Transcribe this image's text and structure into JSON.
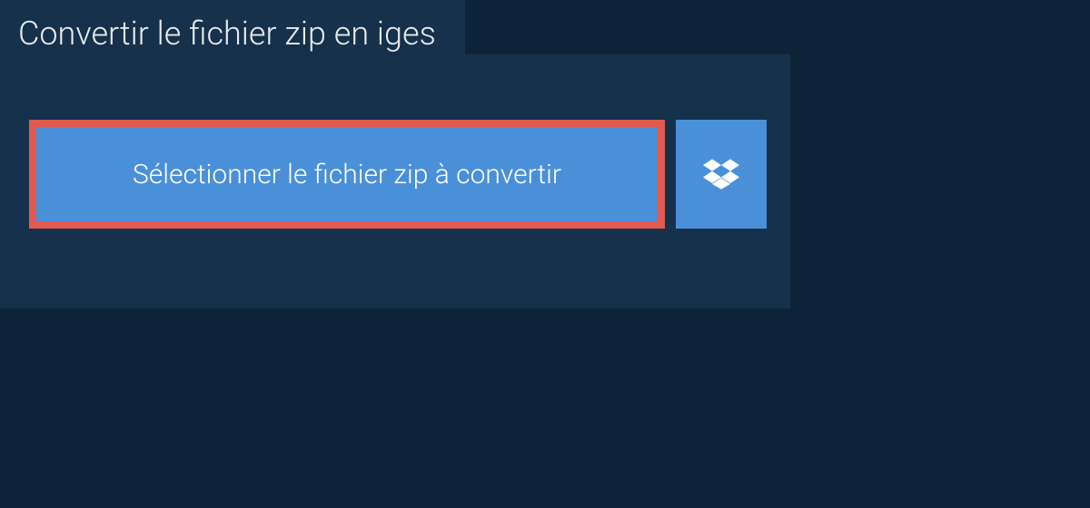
{
  "header": {
    "title": "Convertir le fichier zip en iges"
  },
  "upload": {
    "select_label": "Sélectionner le fichier zip à convertir"
  }
}
